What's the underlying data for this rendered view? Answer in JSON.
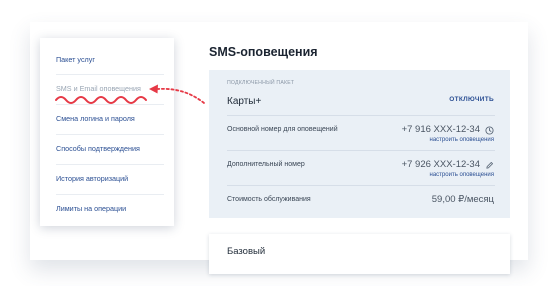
{
  "sidebar": {
    "items": [
      {
        "label": "Пакет услуг"
      },
      {
        "label": "SMS и Email оповещения"
      },
      {
        "label": "Смена логина и пароля"
      },
      {
        "label": "Способы подтверждения"
      },
      {
        "label": "История авторизаций"
      },
      {
        "label": "Лимиты на операции"
      }
    ]
  },
  "main": {
    "title": "SMS-оповещения",
    "package": {
      "caption": "ПОДКЛЮЧЕННЫЙ ПАКЕТ",
      "name": "Карты+",
      "action": "ОТКЛЮЧИТЬ",
      "rows": [
        {
          "label": "Основной номер для оповещений",
          "value": "+7 916 XXX-12-34",
          "sub": "настроить оповещения",
          "icon": "clock-icon"
        },
        {
          "label": "Дополнительный номер",
          "value": "+7 926 XXX-12-34",
          "sub": "настроить оповещения",
          "icon": "pencil-icon"
        },
        {
          "label": "Стоимость обслуживания",
          "value": "59,00 ₽/месяц"
        }
      ]
    },
    "basic": {
      "title": "Базовый"
    }
  },
  "colors": {
    "accent": "#2b4f93",
    "highlight": "#e63946",
    "card_bg": "#eaf0f6"
  }
}
